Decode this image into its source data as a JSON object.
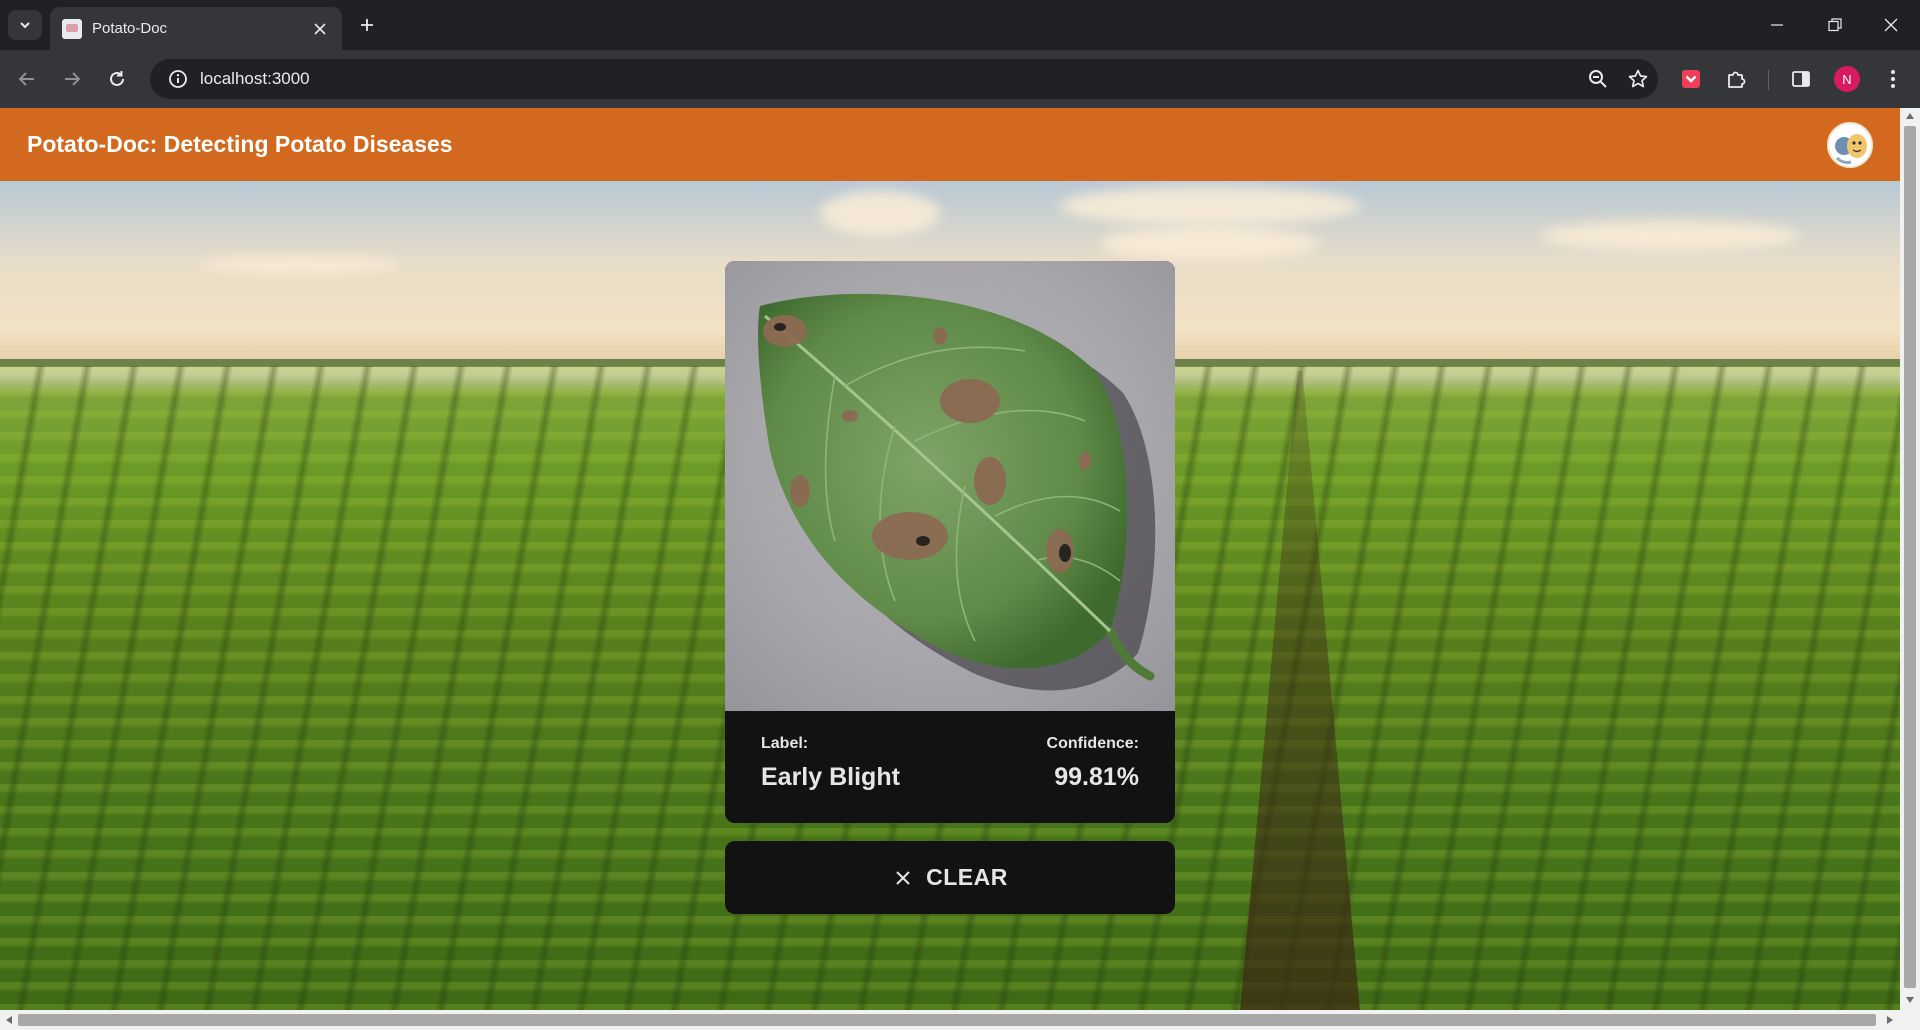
{
  "browser": {
    "tab_title": "Potato-Doc",
    "url": "localhost:3000",
    "profile_initial": "N"
  },
  "app": {
    "title": "Potato-Doc: Detecting Potato Diseases"
  },
  "result": {
    "label_heading": "Label:",
    "label_value": "Early Blight",
    "confidence_heading": "Confidence:",
    "confidence_value": "99.81%"
  },
  "actions": {
    "clear_label": "CLEAR"
  },
  "colors": {
    "appbar": "#d2691e",
    "card": "#121212",
    "card_text": "#e6e6e6"
  }
}
